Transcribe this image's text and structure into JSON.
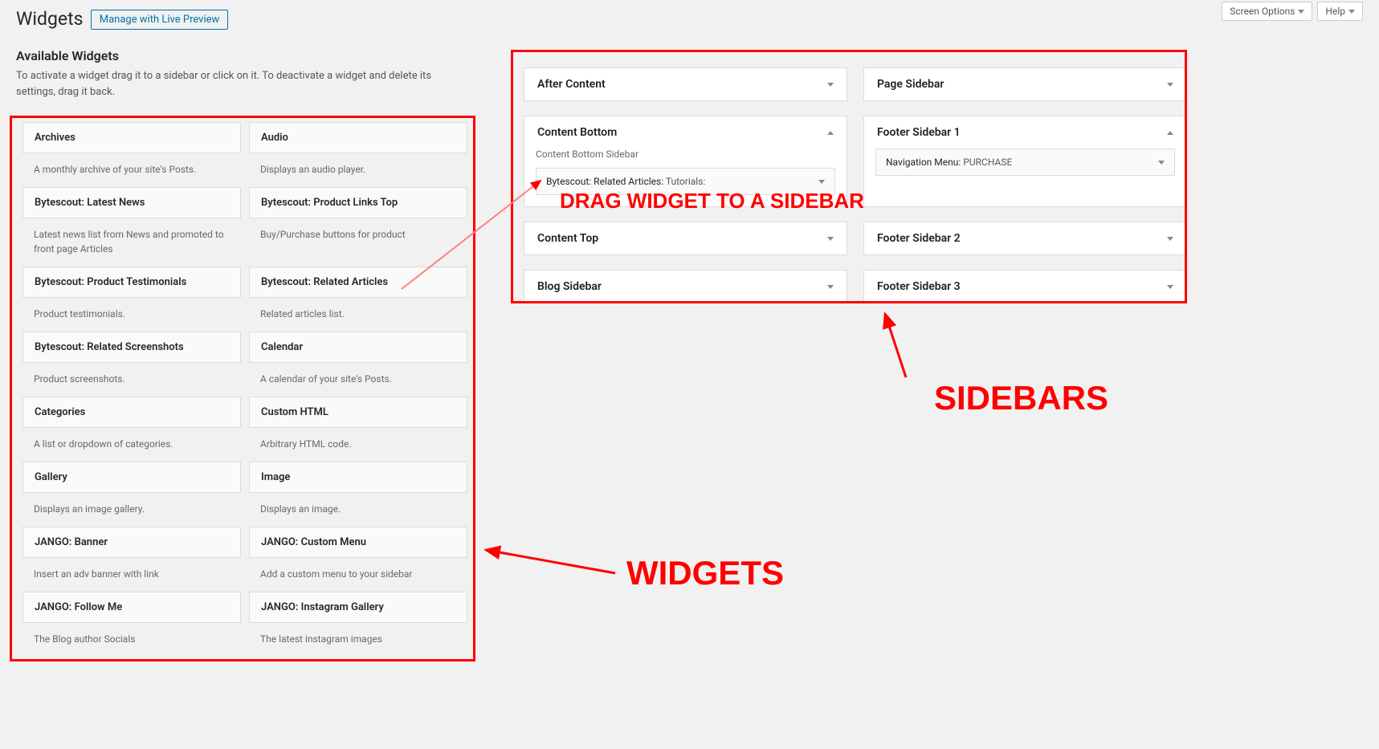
{
  "top": {
    "screen_options": "Screen Options",
    "help": "Help"
  },
  "title": "Widgets",
  "live_preview": "Manage with Live Preview",
  "avail_heading": "Available Widgets",
  "avail_desc": "To activate a widget drag it to a sidebar or click on it. To deactivate a widget and delete its settings, drag it back.",
  "widgets": [
    {
      "name": "Archives",
      "desc": "A monthly archive of your site's Posts."
    },
    {
      "name": "Audio",
      "desc": "Displays an audio player."
    },
    {
      "name": "Bytescout: Latest News",
      "desc": "Latest news list from News and promoted to front page Articles"
    },
    {
      "name": "Bytescout: Product Links Top",
      "desc": "Buy/Purchase buttons for product"
    },
    {
      "name": "Bytescout: Product Testimonials",
      "desc": "Product testimonials."
    },
    {
      "name": "Bytescout: Related Articles",
      "desc": "Related articles list."
    },
    {
      "name": "Bytescout: Related Screenshots",
      "desc": "Product screenshots."
    },
    {
      "name": "Calendar",
      "desc": "A calendar of your site's Posts."
    },
    {
      "name": "Categories",
      "desc": "A list or dropdown of categories."
    },
    {
      "name": "Custom HTML",
      "desc": "Arbitrary HTML code."
    },
    {
      "name": "Gallery",
      "desc": "Displays an image gallery."
    },
    {
      "name": "Image",
      "desc": "Displays an image."
    },
    {
      "name": "JANGO: Banner",
      "desc": "Insert an adv banner with link"
    },
    {
      "name": "JANGO: Custom Menu",
      "desc": "Add a custom menu to your sidebar"
    },
    {
      "name": "JANGO: Follow Me",
      "desc": "The Blog author Socials"
    },
    {
      "name": "JANGO: Instagram Gallery",
      "desc": "The latest instagram images"
    }
  ],
  "sidebars": {
    "after_content": "After Content",
    "page_sidebar": "Page Sidebar",
    "content_bottom": {
      "title": "Content Bottom",
      "desc": "Content Bottom Sidebar",
      "widget_name": "Bytescout: Related Articles:",
      "widget_suffix": "Tutorials:"
    },
    "footer1": {
      "title": "Footer Sidebar 1",
      "widget_name": "Navigation Menu:",
      "widget_suffix": "PURCHASE"
    },
    "content_top": "Content Top",
    "footer2": "Footer Sidebar 2",
    "blog_sidebar": "Blog Sidebar",
    "footer3": "Footer Sidebar 3"
  },
  "annotations": {
    "drag": "DRAG WIDGET TO A SIDEBAR",
    "widgets": "WIDGETS",
    "sidebars": "SIDEBARS"
  }
}
